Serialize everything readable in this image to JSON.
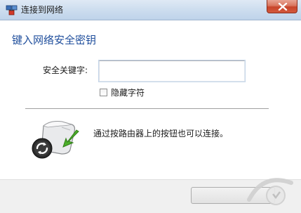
{
  "window": {
    "title": "连接到网络"
  },
  "heading": "键入网络安全密钥",
  "form": {
    "key_label": "安全关键字:",
    "key_value": "",
    "hide_chars_label": "隐藏字符",
    "hide_chars_checked": false
  },
  "wps": {
    "text": "通过按路由器上的按钮也可以连接。"
  },
  "footer": {
    "button_label": ""
  },
  "colors": {
    "heading": "#1f4e9c",
    "titlebar": "#cbdcee",
    "close": "#c7442a",
    "wps_arrow": "#4caf2a"
  },
  "icons": {
    "app": "network-icon",
    "close": "close-icon",
    "router": "router-wps-icon"
  }
}
